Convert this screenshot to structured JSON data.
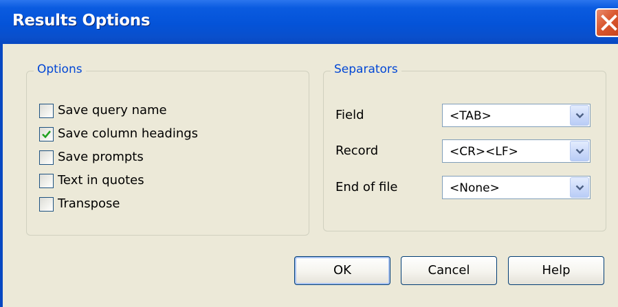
{
  "window": {
    "title": "Results Options"
  },
  "options": {
    "legend": "Options",
    "items": [
      {
        "label": "Save query name",
        "checked": false
      },
      {
        "label": "Save column headings",
        "checked": true
      },
      {
        "label": "Save prompts",
        "checked": false
      },
      {
        "label": "Text in quotes",
        "checked": false
      },
      {
        "label": "Transpose",
        "checked": false
      }
    ]
  },
  "separators": {
    "legend": "Separators",
    "rows": [
      {
        "label": "Field",
        "value": "<TAB>"
      },
      {
        "label": "Record",
        "value": "<CR><LF>"
      },
      {
        "label": "End of file",
        "value": "<None>"
      }
    ]
  },
  "buttons": {
    "ok": "OK",
    "cancel": "Cancel",
    "help": "Help"
  },
  "colors": {
    "titlebar": "#0453D8",
    "dialog_bg": "#ECE9D8",
    "group_legend": "#0046D5",
    "check": "#21A121",
    "close": "#D9572F"
  },
  "icons": {
    "close": "close-icon",
    "check": "checkmark-icon",
    "dropdown": "chevron-down-icon"
  }
}
